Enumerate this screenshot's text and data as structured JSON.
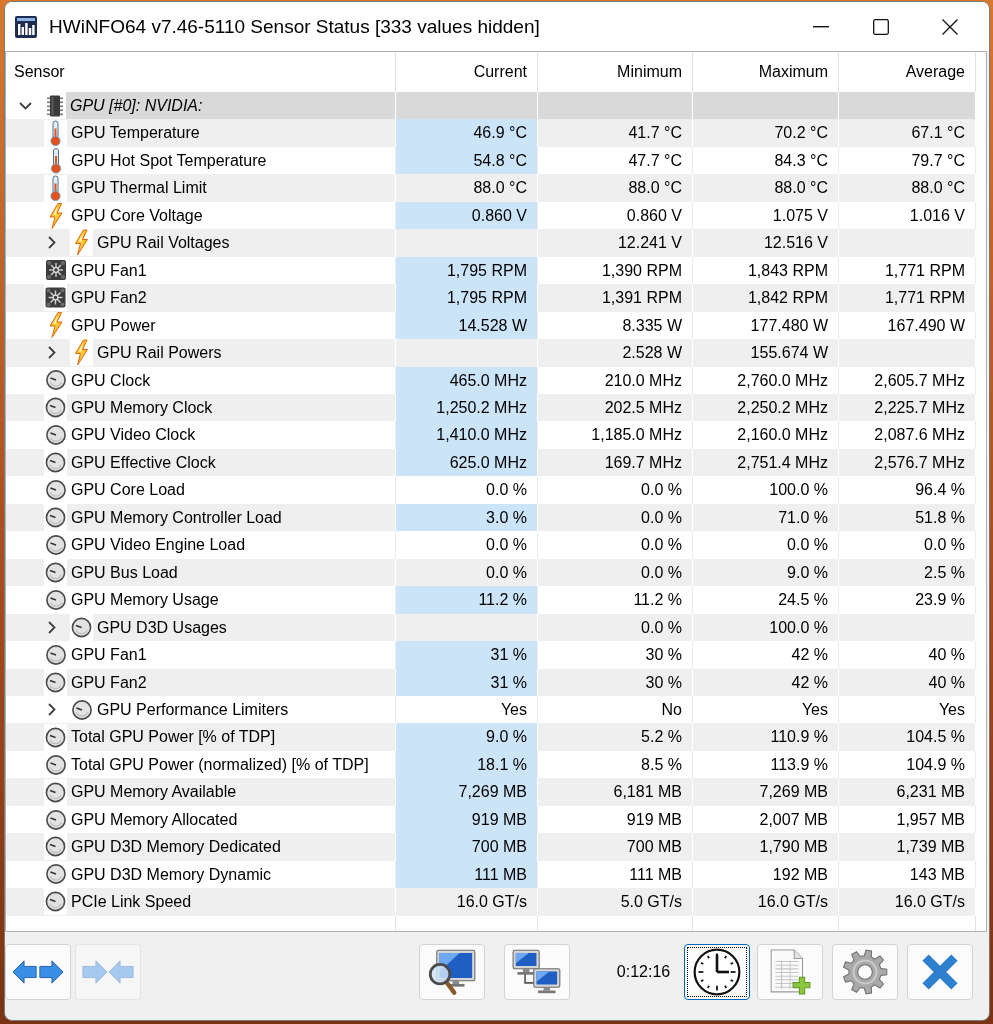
{
  "window": {
    "title": "HWiNFO64 v7.46-5110 Sensor Status [333 values hidden]"
  },
  "table": {
    "columns": [
      "Sensor",
      "Current",
      "Minimum",
      "Maximum",
      "Average"
    ],
    "groups": [
      {
        "label": "GPU [#0]: NVIDIA:",
        "expanded": true,
        "rows": [
          {
            "name": "GPU Temperature",
            "kind": "temperature",
            "current": "46.9 °C",
            "minimum": "41.7 °C",
            "maximum": "70.2 °C",
            "average": "67.1 °C",
            "highlighted": true
          },
          {
            "name": "GPU Hot Spot Temperature",
            "kind": "temperature",
            "current": "54.8 °C",
            "minimum": "47.7 °C",
            "maximum": "84.3 °C",
            "average": "79.7 °C",
            "highlighted": true
          },
          {
            "name": "GPU Thermal Limit",
            "kind": "temperature",
            "current": "88.0 °C",
            "minimum": "88.0 °C",
            "maximum": "88.0 °C",
            "average": "88.0 °C",
            "highlighted": false
          },
          {
            "name": "GPU Core Voltage",
            "kind": "electric",
            "current": "0.860 V",
            "minimum": "0.860 V",
            "maximum": "1.075 V",
            "average": "1.016 V",
            "highlighted": true
          },
          {
            "name": "GPU Rail Voltages",
            "kind": "electric",
            "expanded": false,
            "minimum": "12.241 V",
            "maximum": "12.516 V",
            "highlighted": false
          },
          {
            "name": "GPU Fan1",
            "kind": "fan",
            "current": "1,795 RPM",
            "minimum": "1,390 RPM",
            "maximum": "1,843 RPM",
            "average": "1,771 RPM",
            "highlighted": true
          },
          {
            "name": "GPU Fan2",
            "kind": "fan",
            "current": "1,795 RPM",
            "minimum": "1,391 RPM",
            "maximum": "1,842 RPM",
            "average": "1,771 RPM",
            "highlighted": true
          },
          {
            "name": "GPU Power",
            "kind": "electric",
            "current": "14.528 W",
            "minimum": "8.335 W",
            "maximum": "177.480 W",
            "average": "167.490 W",
            "highlighted": true
          },
          {
            "name": "GPU Rail Powers",
            "kind": "electric",
            "expanded": false,
            "minimum": "2.528 W",
            "maximum": "155.674 W",
            "highlighted": false
          },
          {
            "name": "GPU Clock",
            "kind": "other",
            "current": "465.0 MHz",
            "minimum": "210.0 MHz",
            "maximum": "2,760.0 MHz",
            "average": "2,605.7 MHz",
            "highlighted": true
          },
          {
            "name": "GPU Memory Clock",
            "kind": "other",
            "current": "1,250.2 MHz",
            "minimum": "202.5 MHz",
            "maximum": "2,250.2 MHz",
            "average": "2,225.7 MHz",
            "highlighted": true
          },
          {
            "name": "GPU Video Clock",
            "kind": "other",
            "current": "1,410.0 MHz",
            "minimum": "1,185.0 MHz",
            "maximum": "2,160.0 MHz",
            "average": "2,087.6 MHz",
            "highlighted": true
          },
          {
            "name": "GPU Effective Clock",
            "kind": "other",
            "current": "625.0 MHz",
            "minimum": "169.7 MHz",
            "maximum": "2,751.4 MHz",
            "average": "2,576.7 MHz",
            "highlighted": true
          },
          {
            "name": "GPU Core Load",
            "kind": "other",
            "current": "0.0 %",
            "minimum": "0.0 %",
            "maximum": "100.0 %",
            "average": "96.4 %",
            "highlighted": false
          },
          {
            "name": "GPU Memory Controller Load",
            "kind": "other",
            "current": "3.0 %",
            "minimum": "0.0 %",
            "maximum": "71.0 %",
            "average": "51.8 %",
            "highlighted": true
          },
          {
            "name": "GPU Video Engine Load",
            "kind": "other",
            "current": "0.0 %",
            "minimum": "0.0 %",
            "maximum": "0.0 %",
            "average": "0.0 %",
            "highlighted": false
          },
          {
            "name": "GPU Bus Load",
            "kind": "other",
            "current": "0.0 %",
            "minimum": "0.0 %",
            "maximum": "9.0 %",
            "average": "2.5 %",
            "highlighted": false
          },
          {
            "name": "GPU Memory Usage",
            "kind": "other",
            "current": "11.2 %",
            "minimum": "11.2 %",
            "maximum": "24.5 %",
            "average": "23.9 %",
            "highlighted": true
          },
          {
            "name": "GPU D3D Usages",
            "kind": "other",
            "expanded": false,
            "minimum": "0.0 %",
            "maximum": "100.0 %",
            "highlighted": false
          },
          {
            "name": "GPU Fan1",
            "kind": "other",
            "current": "31 %",
            "minimum": "30 %",
            "maximum": "42 %",
            "average": "40 %",
            "highlighted": true
          },
          {
            "name": "GPU Fan2",
            "kind": "other",
            "current": "31 %",
            "minimum": "30 %",
            "maximum": "42 %",
            "average": "40 %",
            "highlighted": true
          },
          {
            "name": "GPU Performance Limiters",
            "kind": "other",
            "expanded": false,
            "current": "Yes",
            "minimum": "No",
            "maximum": "Yes",
            "average": "Yes",
            "highlighted": false
          },
          {
            "name": "Total GPU Power [% of TDP]",
            "kind": "other",
            "current": "9.0 %",
            "minimum": "5.2 %",
            "maximum": "110.9 %",
            "average": "104.5 %",
            "highlighted": true
          },
          {
            "name": "Total GPU Power (normalized) [% of TDP]",
            "kind": "other",
            "current": "18.1 %",
            "minimum": "8.5 %",
            "maximum": "113.9 %",
            "average": "104.9 %",
            "highlighted": true
          },
          {
            "name": "GPU Memory Available",
            "kind": "other",
            "current": "7,269 MB",
            "minimum": "6,181 MB",
            "maximum": "7,269 MB",
            "average": "6,231 MB",
            "highlighted": true
          },
          {
            "name": "GPU Memory Allocated",
            "kind": "other",
            "current": "919 MB",
            "minimum": "919 MB",
            "maximum": "2,007 MB",
            "average": "1,957 MB",
            "highlighted": true
          },
          {
            "name": "GPU D3D Memory Dedicated",
            "kind": "other",
            "current": "700 MB",
            "minimum": "700 MB",
            "maximum": "1,790 MB",
            "average": "1,739 MB",
            "highlighted": true
          },
          {
            "name": "GPU D3D Memory Dynamic",
            "kind": "other",
            "current": "111 MB",
            "minimum": "111 MB",
            "maximum": "192 MB",
            "average": "143 MB",
            "highlighted": true
          },
          {
            "name": "PCIe Link Speed",
            "kind": "other",
            "current": "16.0 GT/s",
            "minimum": "5.0 GT/s",
            "maximum": "16.0 GT/s",
            "average": "16.0 GT/s",
            "highlighted": false
          }
        ]
      }
    ]
  },
  "toolbar": {
    "left_buttons": [
      {
        "kind": "expand",
        "disabled": false,
        "focused": false
      },
      {
        "kind": "collapse",
        "disabled": true,
        "focused": false
      }
    ],
    "middle_buttons": [
      {
        "kind": "monitor",
        "disabled": false,
        "focused": false
      },
      {
        "kind": "network",
        "disabled": false,
        "focused": false
      }
    ],
    "timer": "0:12:16",
    "right_buttons": [
      {
        "kind": "clock",
        "disabled": false,
        "focused": true
      },
      {
        "kind": "report",
        "disabled": false,
        "focused": false
      },
      {
        "kind": "settings",
        "disabled": false,
        "focused": false
      },
      {
        "kind": "exit",
        "disabled": false,
        "focused": false
      }
    ]
  }
}
